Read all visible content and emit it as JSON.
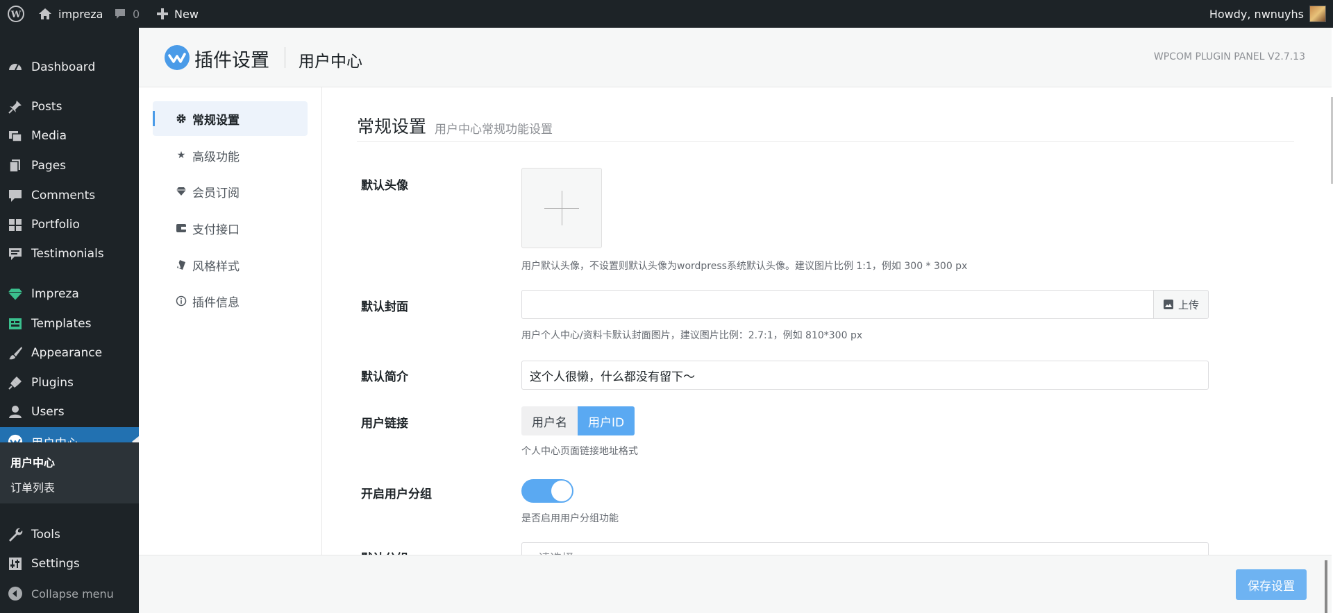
{
  "adminbar": {
    "site_name": "impreza",
    "comments_count": "0",
    "new_label": "New",
    "howdy": "Howdy, nwnuyhs"
  },
  "sidebar": {
    "items": [
      {
        "label": "Dashboard",
        "icon": "dashboard-icon"
      },
      {
        "label": "Posts",
        "icon": "pin-icon"
      },
      {
        "label": "Media",
        "icon": "media-icon"
      },
      {
        "label": "Pages",
        "icon": "pages-icon"
      },
      {
        "label": "Comments",
        "icon": "comment-icon"
      },
      {
        "label": "Portfolio",
        "icon": "portfolio-icon"
      },
      {
        "label": "Testimonials",
        "icon": "testimonial-icon"
      },
      {
        "label": "Impreza",
        "icon": "gem-icon"
      },
      {
        "label": "Templates",
        "icon": "templates-icon"
      },
      {
        "label": "Appearance",
        "icon": "brush-icon"
      },
      {
        "label": "Plugins",
        "icon": "plugin-icon"
      },
      {
        "label": "Users",
        "icon": "user-icon"
      },
      {
        "label": "用户中心",
        "icon": "wpcom-icon"
      },
      {
        "label": "Tools",
        "icon": "wrench-icon"
      },
      {
        "label": "Settings",
        "icon": "settings-icon"
      },
      {
        "label": "Collapse menu",
        "icon": "collapse-icon"
      }
    ],
    "submenu": [
      "用户中心",
      "订单列表"
    ]
  },
  "panel": {
    "title": "插件设置",
    "subtitle": "用户中心",
    "version": "WPCOM PLUGIN PANEL V2.7.13",
    "save_label": "保存设置"
  },
  "tabs": [
    {
      "label": "常规设置",
      "icon": "gear-icon"
    },
    {
      "label": "高级功能",
      "icon": "star-icon"
    },
    {
      "label": "会员订阅",
      "icon": "diamond-icon"
    },
    {
      "label": "支付接口",
      "icon": "wallet-icon"
    },
    {
      "label": "风格样式",
      "icon": "palette-icon"
    },
    {
      "label": "插件信息",
      "icon": "info-icon"
    }
  ],
  "section": {
    "title": "常规设置",
    "desc": "用户中心常规功能设置"
  },
  "fields": {
    "avatar": {
      "label": "默认头像",
      "desc": "用户默认头像，不设置则默认头像为wordpress系统默认头像。建议图片比例 1:1，例如 300 * 300 px"
    },
    "cover": {
      "label": "默认封面",
      "upload_label": "上传",
      "value": "",
      "desc": "用户个人中心/资料卡默认封面图片，建议图片比例：2.7:1，例如 810*300 px"
    },
    "bio": {
      "label": "默认简介",
      "value": "这个人很懒，什么都没有留下～"
    },
    "link": {
      "label": "用户链接",
      "options": [
        "用户名",
        "用户ID"
      ],
      "selected": "用户ID",
      "desc": "个人中心页面链接地址格式"
    },
    "group": {
      "label": "开启用户分组",
      "enabled": true,
      "desc": "是否启用用户分组功能"
    },
    "default_group": {
      "label": "默认分组",
      "placeholder": "--请选择--"
    }
  },
  "colors": {
    "admin_dark": "#1d2327",
    "accent": "#2271b1",
    "toggle_on": "#5aa9f2",
    "save_button": "#6eb3f2"
  }
}
